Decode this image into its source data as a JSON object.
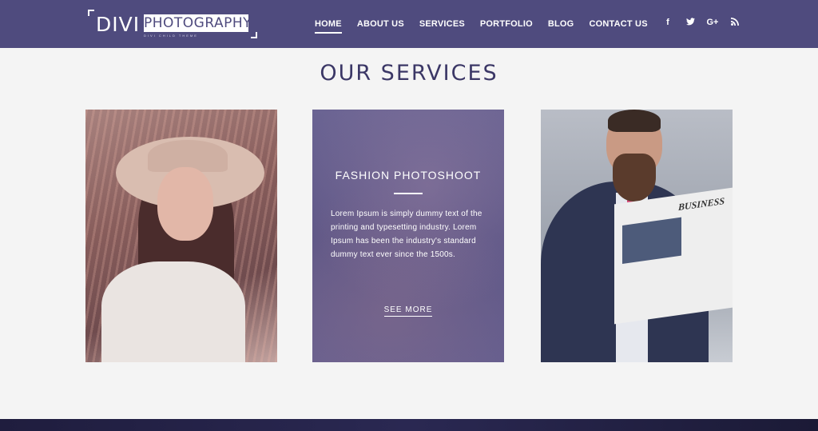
{
  "logo": {
    "divi": "DIVI",
    "photography": "PHOTOGRAPHY",
    "tagline": "DIVI CHILD THEME"
  },
  "nav": {
    "items": [
      "HOME",
      "ABOUT US",
      "SERVICES",
      "PORTFOLIO",
      "BLOG",
      "CONTACT US"
    ],
    "active": "HOME"
  },
  "social": {
    "facebook": "f",
    "twitter": "t",
    "googleplus": "G+",
    "rss": ")))"
  },
  "section": {
    "title": "OUR SERVICES"
  },
  "cards": {
    "middle": {
      "title": "FASHION PHOTOSHOOT",
      "text": "Lorem Ipsum is simply dummy text of the printing and typesetting industry. Lorem Ipsum has been the industry's standard dummy text ever since the 1500s.",
      "button": "SEE MORE"
    },
    "right": {
      "newspaper_headline": "BUSINESS"
    }
  },
  "colors": {
    "header_bg": "#4f4b7e",
    "title_color": "#3b3766",
    "card_overlay": "#5e5787"
  }
}
